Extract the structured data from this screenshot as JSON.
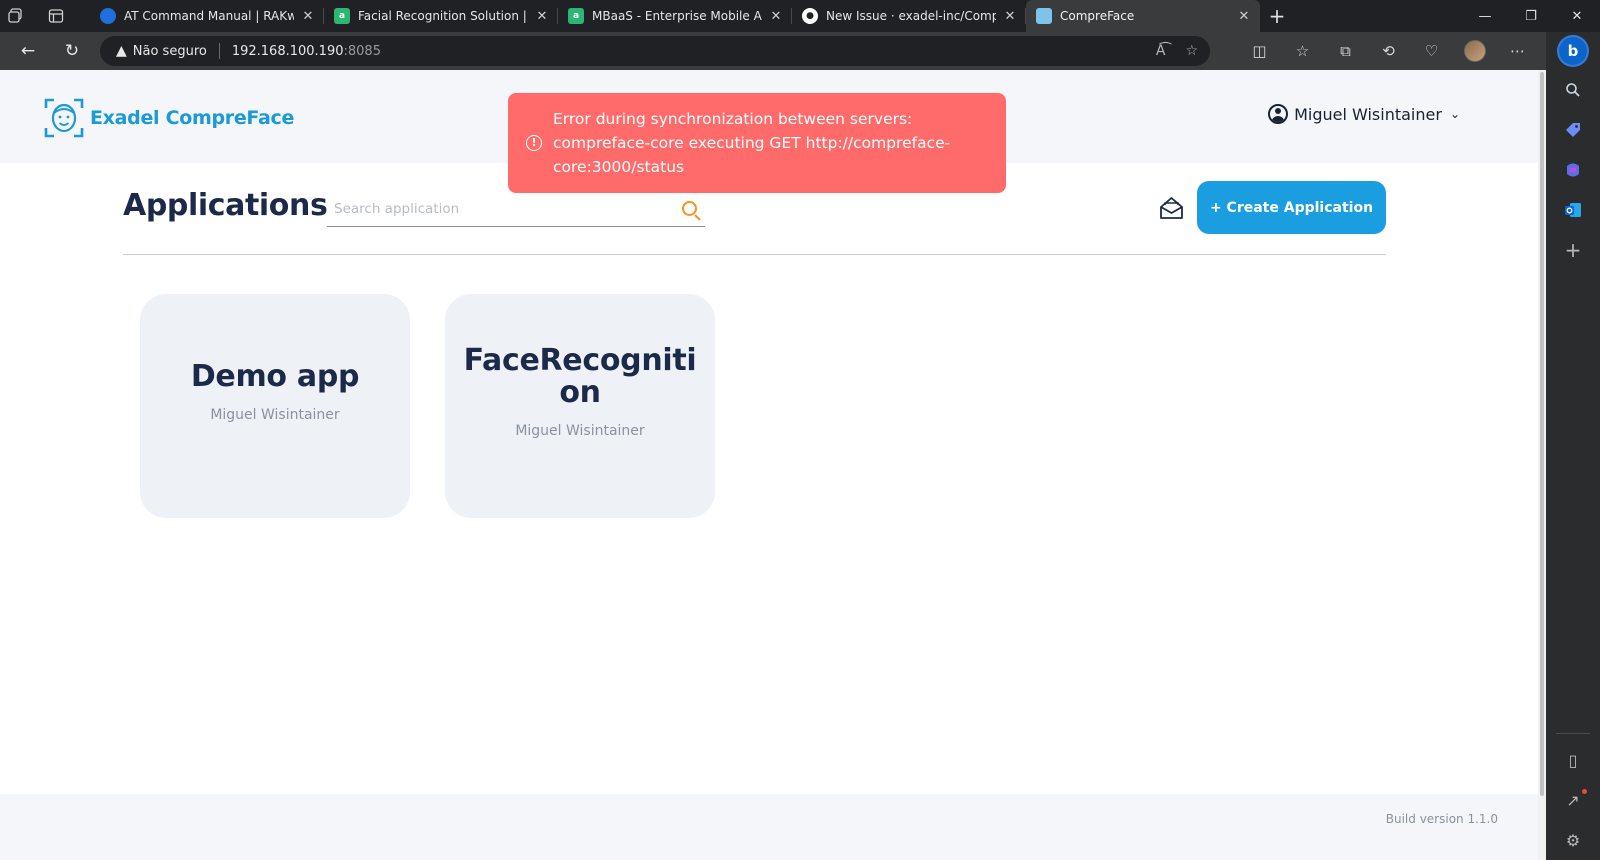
{
  "browser": {
    "tabs": [
      {
        "title": "AT Command Manual | RAKwirele",
        "favicon_color": "#1f6fe0",
        "active": false
      },
      {
        "title": "Facial Recognition Solution | App",
        "favicon_color": "#2bb673",
        "active": false
      },
      {
        "title": "MBaaS - Enterprise Mobile Applic",
        "favicon_color": "#2bb673",
        "active": false
      },
      {
        "title": "New Issue · exadel-inc/CompreFa",
        "favicon_color": "#ffffff",
        "active": false
      },
      {
        "title": "CompreFace",
        "favicon_color": "#7fc4e8",
        "active": true
      }
    ],
    "security_label": "Não seguro",
    "url_host": "192.168.100.190",
    "url_port": ":8085"
  },
  "header": {
    "logo_text": "Exadel CompreFace",
    "user_name": "Miguel Wisintainer"
  },
  "toast": {
    "message": "Error during synchronization between servers: compreface-core executing GET http://compreface-core:3000/status",
    "color": "#ff6b6b"
  },
  "main": {
    "title": "Applications",
    "search_placeholder": "Search application",
    "create_button": "+ Create Application",
    "accent_color": "#1b9ee0"
  },
  "apps": [
    {
      "name": "Demo app",
      "owner": "Miguel Wisintainer"
    },
    {
      "name": "FaceRecognition",
      "owner": "Miguel Wisintainer"
    }
  ],
  "footer": {
    "build_version": "Build version 1.1.0"
  }
}
